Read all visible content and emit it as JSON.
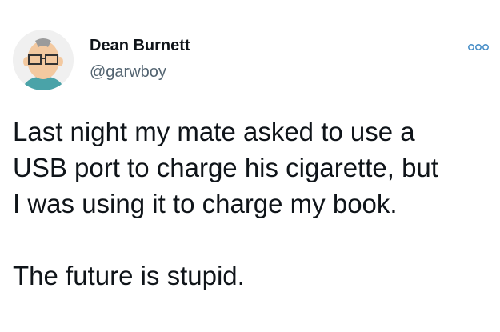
{
  "tweet": {
    "author_name": "Dean Burnett",
    "author_handle": "@garwboy",
    "more_icon": "more-options-icon",
    "avatar_icon": "avatar-cartoon-face",
    "body_lines": [
      "Last night my mate asked to use a",
      "USB port to charge his cigarette, but",
      "I was using it to charge my book."
    ],
    "body_last": "The future is stupid."
  },
  "colors": {
    "text": "#0f1419",
    "secondary_text": "#536471",
    "more_icon": "#4a90c8",
    "skin": "#f3c9a0",
    "hair": "#9b9b9b",
    "shirt": "#4aa3a8"
  }
}
